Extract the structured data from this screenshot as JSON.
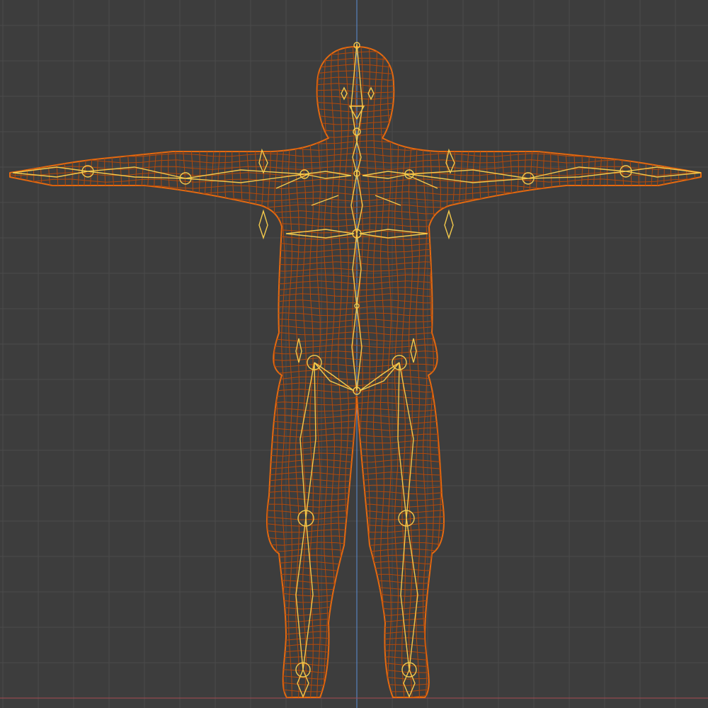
{
  "viewport": {
    "mode": "wireframe",
    "view": "front-orthographic",
    "object": "humanoid-character-mesh",
    "armature": "humanoid-armature",
    "pose": "T-pose",
    "grid": true,
    "icon_names": [
      "character-mesh-icon",
      "armature-icon"
    ]
  },
  "colors": {
    "background": "#3d3d3d",
    "grid": "#4a4a4a",
    "axis_z": "#5a8fd8",
    "axis_x": "#a84a52",
    "mesh_selected": "#e56a10",
    "mesh_dark": "#b3490a",
    "bones": "#f2c84b"
  }
}
